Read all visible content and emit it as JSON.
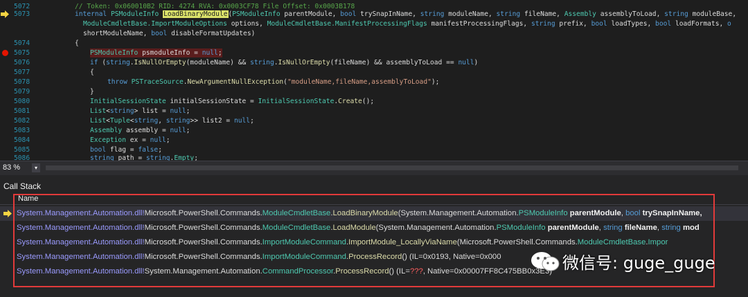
{
  "editor": {
    "lines": [
      {
        "num": "5072",
        "segments": [
          {
            "c": "c",
            "t": "// Token: 0x060010B2 RID: 4274 RVA: 0x0003CF78 File Offset: 0x0003B178"
          }
        ]
      },
      {
        "num": "5073",
        "segments": [
          {
            "c": "k",
            "t": "internal "
          },
          {
            "c": "t",
            "t": "PSModuleInfo "
          },
          {
            "c": "hl",
            "t": "LoadBinaryModule"
          },
          {
            "c": "p",
            "t": "("
          },
          {
            "c": "t",
            "t": "PSModuleInfo "
          },
          {
            "c": "p",
            "t": "parentModule, "
          },
          {
            "c": "k",
            "t": "bool "
          },
          {
            "c": "p",
            "t": "trySnapInName, "
          },
          {
            "c": "k",
            "t": "string "
          },
          {
            "c": "p",
            "t": "moduleName, "
          },
          {
            "c": "k",
            "t": "string "
          },
          {
            "c": "p",
            "t": "fileName, "
          },
          {
            "c": "t",
            "t": "Assembly "
          },
          {
            "c": "p",
            "t": "assemblyToLoad, "
          },
          {
            "c": "k",
            "t": "string "
          },
          {
            "c": "p",
            "t": "moduleBase,"
          }
        ]
      },
      {
        "num": "",
        "segments": [
          {
            "c": "t",
            "t": "ModuleCmdletBase."
          },
          {
            "c": "t",
            "t": "ImportModuleOptions "
          },
          {
            "c": "p",
            "t": "options, "
          },
          {
            "c": "t",
            "t": "ModuleCmdletBase."
          },
          {
            "c": "t",
            "t": "ManifestProcessingFlags "
          },
          {
            "c": "p",
            "t": "manifestProcessingFlags, "
          },
          {
            "c": "k",
            "t": "string "
          },
          {
            "c": "p",
            "t": "prefix, "
          },
          {
            "c": "k",
            "t": "bool "
          },
          {
            "c": "p",
            "t": "loadTypes, "
          },
          {
            "c": "k",
            "t": "bool "
          },
          {
            "c": "p",
            "t": "loadFormats, "
          },
          {
            "c": "k",
            "t": "o"
          }
        ]
      },
      {
        "num": "",
        "segments": [
          {
            "c": "p",
            "t": "shortModuleName, "
          },
          {
            "c": "k",
            "t": "bool "
          },
          {
            "c": "p",
            "t": "disableFormatUpdates)"
          }
        ]
      },
      {
        "num": "5074",
        "segments": [
          {
            "c": "p",
            "t": "{"
          }
        ]
      },
      {
        "num": "5075",
        "segments": [
          {
            "c": "t",
            "t": "PSModuleInfo "
          },
          {
            "c": "p",
            "t": "psmoduleInfo = "
          },
          {
            "c": "k",
            "t": "null"
          },
          {
            "c": "p",
            "t": ";"
          }
        ]
      },
      {
        "num": "5076",
        "segments": [
          {
            "c": "k",
            "t": "if "
          },
          {
            "c": "p",
            "t": "("
          },
          {
            "c": "k",
            "t": "string"
          },
          {
            "c": "p",
            "t": "."
          },
          {
            "c": "m",
            "t": "IsNullOrEmpty"
          },
          {
            "c": "p",
            "t": "(moduleName) && "
          },
          {
            "c": "k",
            "t": "string"
          },
          {
            "c": "p",
            "t": "."
          },
          {
            "c": "m",
            "t": "IsNullOrEmpty"
          },
          {
            "c": "p",
            "t": "(fileName) && assemblyToLoad == "
          },
          {
            "c": "k",
            "t": "null"
          },
          {
            "c": "p",
            "t": ")"
          }
        ]
      },
      {
        "num": "5077",
        "segments": [
          {
            "c": "p",
            "t": "{"
          }
        ]
      },
      {
        "num": "5078",
        "segments": [
          {
            "c": "k",
            "t": "throw "
          },
          {
            "c": "t",
            "t": "PSTraceSource"
          },
          {
            "c": "p",
            "t": "."
          },
          {
            "c": "m",
            "t": "NewArgumentNullException"
          },
          {
            "c": "p",
            "t": "("
          },
          {
            "c": "s",
            "t": "\"moduleName,fileName,assemblyToLoad\""
          },
          {
            "c": "p",
            "t": ");"
          }
        ]
      },
      {
        "num": "5079",
        "segments": [
          {
            "c": "p",
            "t": "}"
          }
        ]
      },
      {
        "num": "5080",
        "segments": [
          {
            "c": "t",
            "t": "InitialSessionState "
          },
          {
            "c": "p",
            "t": "initialSessionState = "
          },
          {
            "c": "t",
            "t": "InitialSessionState"
          },
          {
            "c": "p",
            "t": "."
          },
          {
            "c": "m",
            "t": "Create"
          },
          {
            "c": "p",
            "t": "();"
          }
        ]
      },
      {
        "num": "5081",
        "segments": [
          {
            "c": "t",
            "t": "List"
          },
          {
            "c": "p",
            "t": "<"
          },
          {
            "c": "k",
            "t": "string"
          },
          {
            "c": "p",
            "t": "> list = "
          },
          {
            "c": "k",
            "t": "null"
          },
          {
            "c": "p",
            "t": ";"
          }
        ]
      },
      {
        "num": "5082",
        "segments": [
          {
            "c": "t",
            "t": "List"
          },
          {
            "c": "p",
            "t": "<"
          },
          {
            "c": "t",
            "t": "Tuple"
          },
          {
            "c": "p",
            "t": "<"
          },
          {
            "c": "k",
            "t": "string"
          },
          {
            "c": "p",
            "t": ", "
          },
          {
            "c": "k",
            "t": "string"
          },
          {
            "c": "p",
            "t": ">> list2 = "
          },
          {
            "c": "k",
            "t": "null"
          },
          {
            "c": "p",
            "t": ";"
          }
        ]
      },
      {
        "num": "5083",
        "segments": [
          {
            "c": "t",
            "t": "Assembly "
          },
          {
            "c": "p",
            "t": "assembly = "
          },
          {
            "c": "k",
            "t": "null"
          },
          {
            "c": "p",
            "t": ";"
          }
        ]
      },
      {
        "num": "5084",
        "segments": [
          {
            "c": "t",
            "t": "Exception "
          },
          {
            "c": "p",
            "t": "ex = "
          },
          {
            "c": "k",
            "t": "null"
          },
          {
            "c": "p",
            "t": ";"
          }
        ]
      },
      {
        "num": "5085",
        "segments": [
          {
            "c": "k",
            "t": "bool "
          },
          {
            "c": "p",
            "t": "flag = "
          },
          {
            "c": "k",
            "t": "false"
          },
          {
            "c": "p",
            "t": ";"
          }
        ]
      },
      {
        "num": "5086",
        "segments": [
          {
            "c": "k",
            "t": "string "
          },
          {
            "c": "p",
            "t": "path = "
          },
          {
            "c": "k",
            "t": "string"
          },
          {
            "c": "p",
            "t": "."
          },
          {
            "c": "t",
            "t": "Empty"
          },
          {
            "c": "p",
            "t": ";"
          }
        ]
      }
    ]
  },
  "status": {
    "zoom": "83 %",
    "zoom_arrow": "▾"
  },
  "callstack": {
    "title": "Call Stack",
    "column": "Name",
    "rows": [
      [
        {
          "c": "g",
          "t": "System.Management.Automation.dll!"
        },
        {
          "c": "p",
          "t": "Microsoft.PowerShell.Commands."
        },
        {
          "c": "cls",
          "t": "ModuleCmdletBase"
        },
        {
          "c": "p",
          "t": "."
        },
        {
          "c": "fn",
          "t": "LoadBinaryModule"
        },
        {
          "c": "p",
          "t": "(System.Management.Automation."
        },
        {
          "c": "cls",
          "t": "PSModuleInfo "
        },
        {
          "c": "pm",
          "t": "parentModule"
        },
        {
          "c": "p",
          "t": ", "
        },
        {
          "c": "kw",
          "t": "bool "
        },
        {
          "c": "pm",
          "t": "trySnapInName,"
        }
      ],
      [
        {
          "c": "g",
          "t": "System.Management.Automation.dll!"
        },
        {
          "c": "p",
          "t": "Microsoft.PowerShell.Commands."
        },
        {
          "c": "cls",
          "t": "ModuleCmdletBase"
        },
        {
          "c": "p",
          "t": "."
        },
        {
          "c": "fn",
          "t": "LoadModule"
        },
        {
          "c": "p",
          "t": "(System.Management.Automation."
        },
        {
          "c": "cls",
          "t": "PSModuleInfo "
        },
        {
          "c": "pm",
          "t": "parentModule"
        },
        {
          "c": "p",
          "t": ", "
        },
        {
          "c": "kw",
          "t": "string "
        },
        {
          "c": "pm",
          "t": "fileName"
        },
        {
          "c": "p",
          "t": ", "
        },
        {
          "c": "kw",
          "t": "string "
        },
        {
          "c": "pm",
          "t": "mod"
        }
      ],
      [
        {
          "c": "g",
          "t": "System.Management.Automation.dll!"
        },
        {
          "c": "p",
          "t": "Microsoft.PowerShell.Commands."
        },
        {
          "c": "cls",
          "t": "ImportModuleCommand"
        },
        {
          "c": "p",
          "t": "."
        },
        {
          "c": "fn",
          "t": "ImportModule_LocallyViaName"
        },
        {
          "c": "p",
          "t": "(Microsoft.PowerShell.Commands."
        },
        {
          "c": "cls",
          "t": "ModuleCmdletBase"
        },
        {
          "c": "p",
          "t": "."
        },
        {
          "c": "cls",
          "t": "Impor"
        }
      ],
      [
        {
          "c": "g",
          "t": "System.Management.Automation.dll!"
        },
        {
          "c": "p",
          "t": "Microsoft.PowerShell.Commands."
        },
        {
          "c": "cls",
          "t": "ImportModuleCommand"
        },
        {
          "c": "p",
          "t": "."
        },
        {
          "c": "fn",
          "t": "ProcessRecord"
        },
        {
          "c": "p",
          "t": "() (IL=0x0193, Native=0x000"
        }
      ],
      [
        {
          "c": "g",
          "t": "System.Management.Automation.dll!"
        },
        {
          "c": "p",
          "t": "System.Management.Automation."
        },
        {
          "c": "cls",
          "t": "CommandProcessor"
        },
        {
          "c": "p",
          "t": "."
        },
        {
          "c": "fn",
          "t": "ProcessRecord"
        },
        {
          "c": "p",
          "t": "() (IL="
        },
        {
          "c": "red",
          "t": "???"
        },
        {
          "c": "p",
          "t": ", Native=0x00007FF8C475BB"
        },
        {
          "c": "p",
          "t": "0x3E3)"
        }
      ]
    ]
  },
  "watermark": {
    "text": "微信号: guge_guge",
    "icon": "wechat-icon"
  },
  "colors": {
    "accent": "#e23a3a",
    "highlight": "#dbe26a"
  }
}
